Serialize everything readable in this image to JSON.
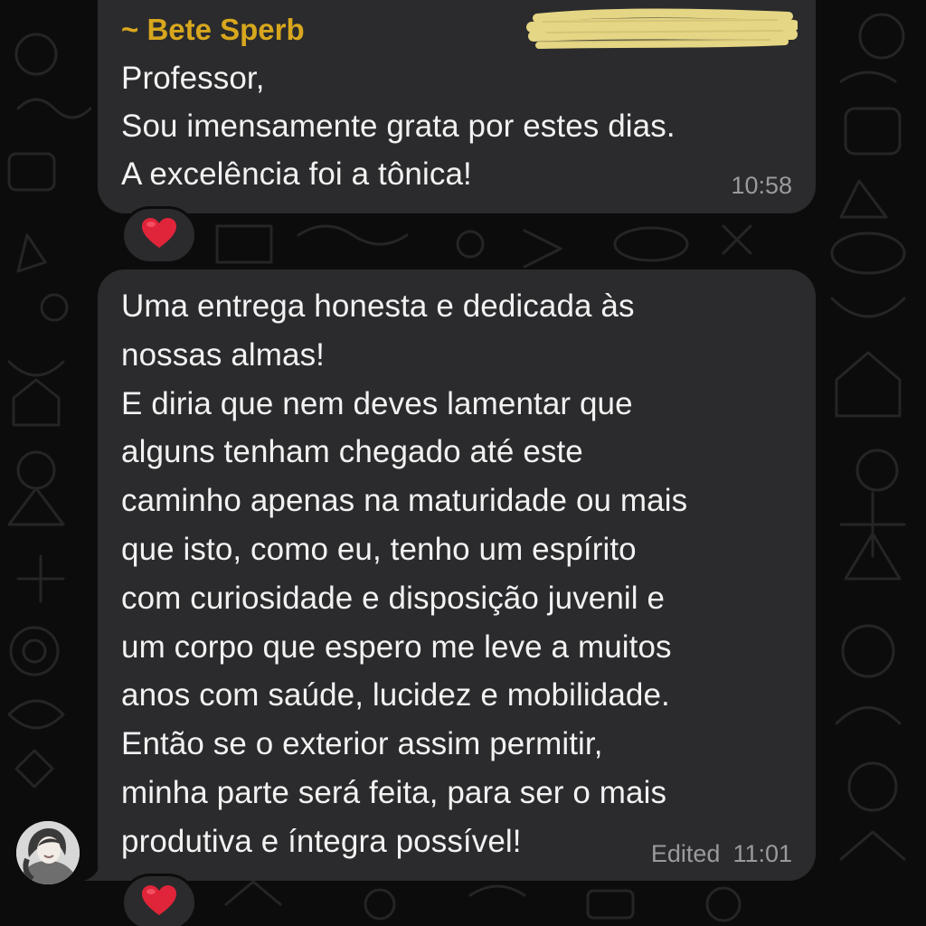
{
  "chat": {
    "messages": [
      {
        "sender": "~ Bete Sperb",
        "text": "Professor,\nSou imensamente grata por estes dias.\nA excelência foi a tônica!",
        "time": "10:58",
        "reaction": "❤️"
      },
      {
        "text": "Uma entrega honesta e dedicada às\nnossas almas!\nE diria que nem deves lamentar que\nalguns tenham chegado até este\ncaminho apenas na maturidade ou mais\nque isto, como eu, tenho um espírito\ncom curiosidade e disposição juvenil e\num corpo que espero me leve a muitos\nanos com saúde, lucidez e mobilidade.\nEntão se o exterior assim permitir,\nminha parte será feita, para ser o mais\nprodutiva e íntegra possível!",
        "edited_label": "Edited",
        "time": "11:01",
        "reaction": "❤️"
      }
    ]
  },
  "colors": {
    "background": "#0c0c0c",
    "bubble": "#2b2b2d",
    "sender_name": "#d8a71d",
    "text": "#f2f2f2",
    "meta": "#9a9a9e",
    "redaction_highlight": "#efe08a",
    "heart": "#e0243a"
  },
  "icons": {
    "reaction": "heart-icon",
    "avatar": "sender-avatar"
  }
}
